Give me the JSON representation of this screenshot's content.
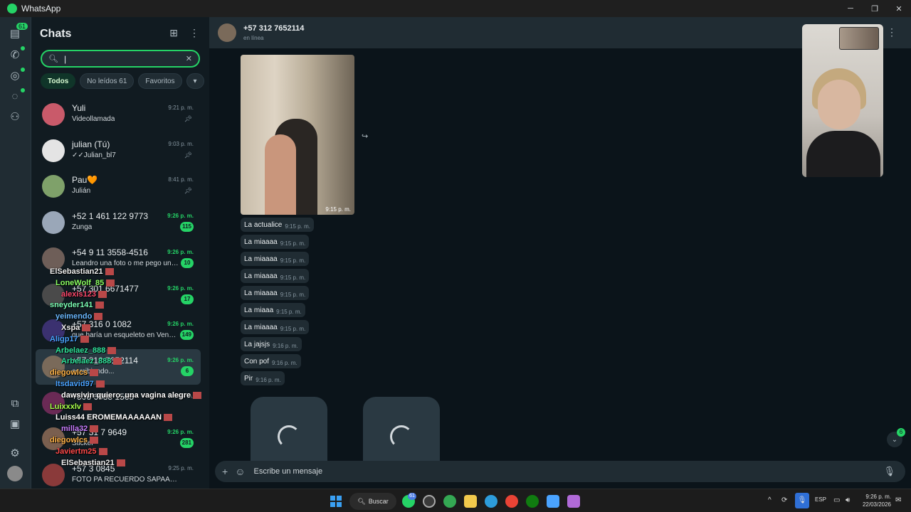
{
  "window": {
    "title": "WhatsApp"
  },
  "rail": {
    "chats_badge": "61"
  },
  "chatlist": {
    "title": "Chats",
    "search_value": "|",
    "filters": [
      {
        "label": "Todos"
      },
      {
        "label": "No leídos 61"
      },
      {
        "label": "Favoritos"
      },
      {
        "label": "▾"
      }
    ],
    "rows": [
      {
        "name": "Yuli",
        "preview": "Videollamada",
        "time": "9:21 p. m.",
        "count": "",
        "pinned": true,
        "avatar": "#c95a6a"
      },
      {
        "name": "julian (Tú)",
        "preview": "✓✓Julian_bl7",
        "time": "9:03 p. m.",
        "count": "",
        "pinned": true,
        "avatar": "#e4e4e4"
      },
      {
        "name": "Pau🧡",
        "preview": "Julián",
        "time": "8:41 p. m.",
        "count": "",
        "pinned": true,
        "avatar": "#7fa16a"
      },
      {
        "name": "+52 1 461 122 9773",
        "preview": "Zunga",
        "time": "9:26 p. m.",
        "count": "115",
        "pinned": false,
        "avatar": "#9aa7b8"
      },
      {
        "name": "+54 9 11 3558-4516",
        "preview": "Leandro una foto o me pego un tiro",
        "time": "9:26 p. m.",
        "count": "10",
        "pinned": false,
        "avatar": "#6e5e58"
      },
      {
        "name": "+57 301 6671477",
        "preview": "",
        "time": "9:26 p. m.",
        "count": "17",
        "pinned": false,
        "avatar": "#4a4a4a"
      },
      {
        "name": "+57 316 0 1082",
        "preview": "que haría un esqueleto en Venezu...",
        "time": "9:26 p. m.",
        "count": "149",
        "pinned": false,
        "avatar": "#3b3170"
      },
      {
        "name": "+57 312 7652114",
        "preview": "escribiendo...",
        "time": "9:26 p. m.",
        "count": "6",
        "pinned": false,
        "avatar": "#7a6a5a"
      },
      {
        "name": "+506 6088 1565",
        "preview": "",
        "time": "9:26 p. m.",
        "count": "",
        "pinned": false,
        "avatar": "#6a2a55"
      },
      {
        "name": "+57 31 7 9649",
        "preview": "Sticker",
        "time": "9:26 p. m.",
        "count": "281",
        "pinned": false,
        "avatar": "#7a5f4f"
      },
      {
        "name": "+57 3 0845",
        "preview": "FOTO PA RECUERDO SAPAAAA, ...",
        "time": "9:25 p. m.",
        "count": "",
        "pinned": false,
        "avatar": "#8a3a3a"
      }
    ]
  },
  "stream_overlay": [
    {
      "text": "ElSebastian21",
      "color": "#f0f0f0"
    },
    {
      "text": "LoneWolf_85",
      "color": "#8bff62"
    },
    {
      "text": "alexis123",
      "color": "#ff4a6e"
    },
    {
      "text": "sneyder141",
      "color": "#7cffb6"
    },
    {
      "text": "yeimendo",
      "color": "#6ab8ff"
    },
    {
      "text": "Xspa",
      "color": "#f0f0f0"
    },
    {
      "text": "Aligp17",
      "color": "#4aa3ff"
    },
    {
      "text": "Arbelaez_888",
      "color": "#2fe39b"
    },
    {
      "text": "Arbelaez_888",
      "color": "#2fe39b"
    },
    {
      "text": "diegowlcs",
      "color": "#ffb347"
    },
    {
      "text": "Itsdavid97",
      "color": "#4aa3ff"
    },
    {
      "text": "dawsivin quiero. una vagina alegre",
      "color": "#ffffff"
    },
    {
      "text": "Luixxxlv",
      "color": "#a7ff4a"
    },
    {
      "text": "Luiss44 EROMEMAAAAAAN",
      "color": "#ffffff"
    },
    {
      "text": "milla32",
      "color": "#c77dff"
    },
    {
      "text": "diegowlcs",
      "color": "#ffb347"
    },
    {
      "text": "Javiertm25",
      "color": "#ff4a4a"
    },
    {
      "text": "ElSebastian21",
      "color": "#f0f0f0"
    }
  ],
  "chat": {
    "contact": "+57 312 7652114",
    "status": "en línea",
    "photo_time": "9:15 p. m.",
    "messages": [
      {
        "text": "La actualice",
        "time": "9:15 p. m."
      },
      {
        "text": "La miaaaa",
        "time": "9:15 p. m."
      },
      {
        "text": "La miaaaa",
        "time": "9:15 p. m."
      },
      {
        "text": "La miaaaa",
        "time": "9:15 p. m."
      },
      {
        "text": "La miaaaa",
        "time": "9:15 p. m."
      },
      {
        "text": "La miaaa",
        "time": "9:15 p. m."
      },
      {
        "text": "La miaaaa",
        "time": "9:15 p. m."
      },
      {
        "text": "La jajsjs",
        "time": "9:16 p. m."
      },
      {
        "text": "Con pof",
        "time": "9:16 p. m."
      },
      {
        "text": "Pir",
        "time": "9:16 p. m."
      }
    ],
    "unread_badge": "6",
    "composer_placeholder": "Escribe un mensaje"
  },
  "taskbar": {
    "search_label": "Buscar",
    "whatsapp_badge": "61",
    "lang": "ESP",
    "time": "9:26 p. m.",
    "date": "22/03/2026"
  },
  "colors": {
    "accent": "#25d366",
    "panel": "#202c33",
    "background": "#0b141a"
  }
}
